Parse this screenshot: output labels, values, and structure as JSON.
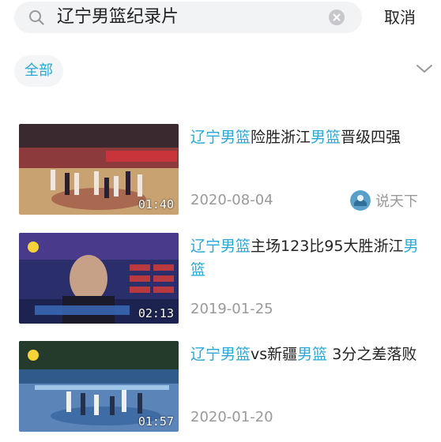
{
  "search": {
    "query": "辽宁男篮纪录片",
    "cancel_label": "取消"
  },
  "filter": {
    "selected": "全部"
  },
  "results": [
    {
      "title_parts": [
        {
          "text": "辽宁男篮",
          "hl": true
        },
        {
          "text": "险胜浙江",
          "hl": false
        },
        {
          "text": "男篮",
          "hl": true
        },
        {
          "text": "晋级四强",
          "hl": false
        }
      ],
      "date": "2020-08-04",
      "duration": "01:40",
      "source": "说天下",
      "thumb_colors": {
        "top": "#3a2a30",
        "mid": "#8c3a3c",
        "floor": "#c9a272",
        "accent": "#d8333a"
      }
    },
    {
      "title_parts": [
        {
          "text": "辽宁男篮",
          "hl": true
        },
        {
          "text": "主场123比95大胜浙江",
          "hl": false
        },
        {
          "text": "男篮",
          "hl": true
        }
      ],
      "date": "2019-01-25",
      "duration": "02:13",
      "source": "",
      "thumb_colors": {
        "top": "#4a3a8c",
        "mid": "#2a2e6a",
        "floor": "#1d2350",
        "accent": "#f5d23a"
      }
    },
    {
      "title_parts": [
        {
          "text": "辽宁男篮",
          "hl": true
        },
        {
          "text": "vs新疆",
          "hl": false
        },
        {
          "text": "男篮",
          "hl": true
        },
        {
          "text": " 3分之差落败",
          "hl": false
        }
      ],
      "date": "2020-01-20",
      "duration": "01:57",
      "source": "",
      "thumb_colors": {
        "top": "#243b2c",
        "mid": "#2f5a8a",
        "floor": "#5b84b8",
        "accent": "#9fc6e8"
      }
    }
  ],
  "colors": {
    "highlight": "#2aa7d6",
    "secondary_text": "#999999",
    "search_bg": "#f2f3f5"
  }
}
